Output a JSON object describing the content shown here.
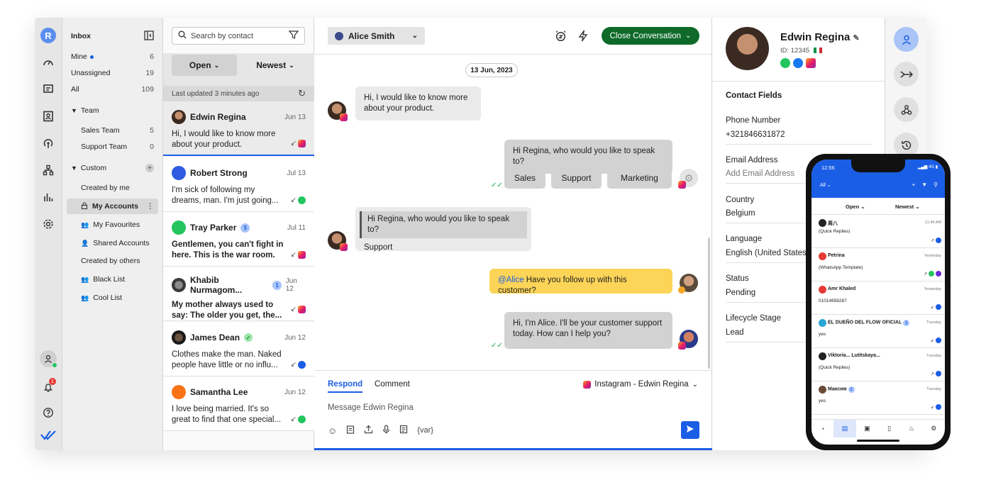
{
  "rail": {
    "avatar_letter": "R",
    "notif_badge": "1"
  },
  "nav": {
    "inbox": "Inbox",
    "mine": "Mine",
    "mine_count": "6",
    "unassigned": "Unassigned",
    "unassigned_count": "19",
    "all": "All",
    "all_count": "109",
    "team": "Team",
    "sales_team": "Sales Team",
    "sales_count": "5",
    "support_team": "Support Team",
    "support_count": "0",
    "custom": "Custom",
    "created_by_me": "Created by me",
    "my_accounts": "My Accounts",
    "my_favourites": "My Favourites",
    "shared_accounts": "Shared Accounts",
    "created_by_others": "Created by others",
    "black_list": "Black List",
    "cool_list": "Cool List"
  },
  "list": {
    "search_placeholder": "Search by contact",
    "status_filter": "Open",
    "sort_filter": "Newest",
    "last_updated": "Last updated 3 minutes ago",
    "conversations": [
      {
        "name": "Edwin Regina",
        "date": "Jun 13",
        "msg": "Hi, I would like to know more about your product.",
        "badge": ""
      },
      {
        "name": "Robert Strong",
        "date": "Jul 13",
        "msg": "I'm sick of following my dreams, man. I'm just going...",
        "badge": ""
      },
      {
        "name": "Tray Parker",
        "date": "Jul 11",
        "msg": "Gentlemen, you can't fight in here. This is the war room.",
        "badge": "5"
      },
      {
        "name": "Khabib Nurmagom...",
        "date": "Jun 12",
        "msg": "My mother always used to say: The older you get, the...",
        "badge": "1"
      },
      {
        "name": "James Dean",
        "date": "Jun 12",
        "msg": "Clothes make the man. Naked people have little or no influ...",
        "badge": ""
      },
      {
        "name": "Samantha Lee",
        "date": "Jun 12",
        "msg": "I love being married. It's so great to find that one special...",
        "badge": ""
      }
    ]
  },
  "chat": {
    "agent": "Alice Smith",
    "close_label": "Close Conversation",
    "date_pill": "13 Jun, 2023",
    "msg1": "Hi, I would like to know more about your product.",
    "msg2": "Hi Regina, who would you like to speak to?",
    "qr1": "Sales",
    "qr2": "Support",
    "qr3": "Marketing",
    "quote": "Hi Regina, who would you like to speak to?",
    "reply": "Support",
    "note_mention": "@Alice",
    "note_text": " Have you follow up with this customer?",
    "msg3": "Hi, I'm Alice. I'll be your customer support today. How can I help you?",
    "tab_respond": "Respond",
    "tab_comment": "Comment",
    "channel": "Instagram - Edwin Regina",
    "placeholder": "Message Edwin Regina",
    "var": "{var}"
  },
  "profile": {
    "name": "Edwin Regina",
    "id": "ID: 12345",
    "section": "Contact Fields",
    "phone_label": "Phone Number",
    "phone": "+321846631872",
    "email_label": "Email Address",
    "email_placeholder": "Add Email Address",
    "country_label": "Country",
    "country": "Belgium",
    "language_label": "Language",
    "language": "English (United States)",
    "status_label": "Status",
    "status": "Pending",
    "lifecycle_label": "Lifecycle Stage",
    "lifecycle": "Lead"
  },
  "phone": {
    "time": "12:56",
    "signal": "4G",
    "filter_all": "All",
    "status_filter": "Open",
    "sort_filter": "Newest",
    "rows": [
      {
        "name": "周八",
        "date": "11:46 AM",
        "sub": "(Quick Replies)"
      },
      {
        "name": "Petrina",
        "date": "Yesterday",
        "sub": "(WhatsApp Template)"
      },
      {
        "name": "Amr Khaled",
        "date": "Yesterday",
        "sub": "01014658287"
      },
      {
        "name": "EL DUEÑO DEL FLOW OFICIAL",
        "date": "Tuesday",
        "sub": "yes",
        "badge": "1"
      },
      {
        "name": "Viktoria... Lutitskaya...",
        "date": "Tuesday",
        "sub": "(Quick Replies)"
      },
      {
        "name": "Максим",
        "date": "Tuesday",
        "sub": "yes",
        "badge": "1"
      }
    ]
  },
  "colors": {
    "accent": "#1b5ee6",
    "close_button": "#0f6a2a",
    "note": "#fcd457"
  }
}
